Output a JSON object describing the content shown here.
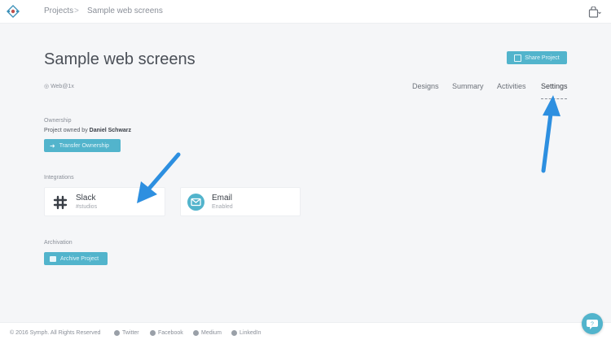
{
  "breadcrumb": {
    "projects": "Projects",
    "separator": ">",
    "current": "Sample web screens"
  },
  "header": {
    "title": "Sample web screens",
    "share_label": "Share Project",
    "platform_tag": "Web@1x"
  },
  "tabs": [
    {
      "label": "Designs"
    },
    {
      "label": "Summary"
    },
    {
      "label": "Activities"
    },
    {
      "label": "Settings",
      "active": true
    }
  ],
  "ownership": {
    "section_label": "Ownership",
    "owner_prefix": "Project owned by",
    "owner_name": "Daniel Schwarz",
    "transfer_label": "Transfer Ownership"
  },
  "integrations": {
    "section_label": "Integrations",
    "cards": [
      {
        "name": "Slack",
        "status": "#studios",
        "icon": "slack-icon"
      },
      {
        "name": "Email",
        "status": "Enabled",
        "icon": "mail-icon"
      }
    ]
  },
  "archivation": {
    "section_label": "Archivation",
    "archive_label": "Archive Project"
  },
  "footer": {
    "copyright": "© 2016 Symph. All Rights Reserved",
    "links": [
      "Twitter",
      "Facebook",
      "Medium",
      "LinkedIn"
    ]
  },
  "colors": {
    "accent": "#52b4cc",
    "arrow": "#2d8fe0"
  }
}
